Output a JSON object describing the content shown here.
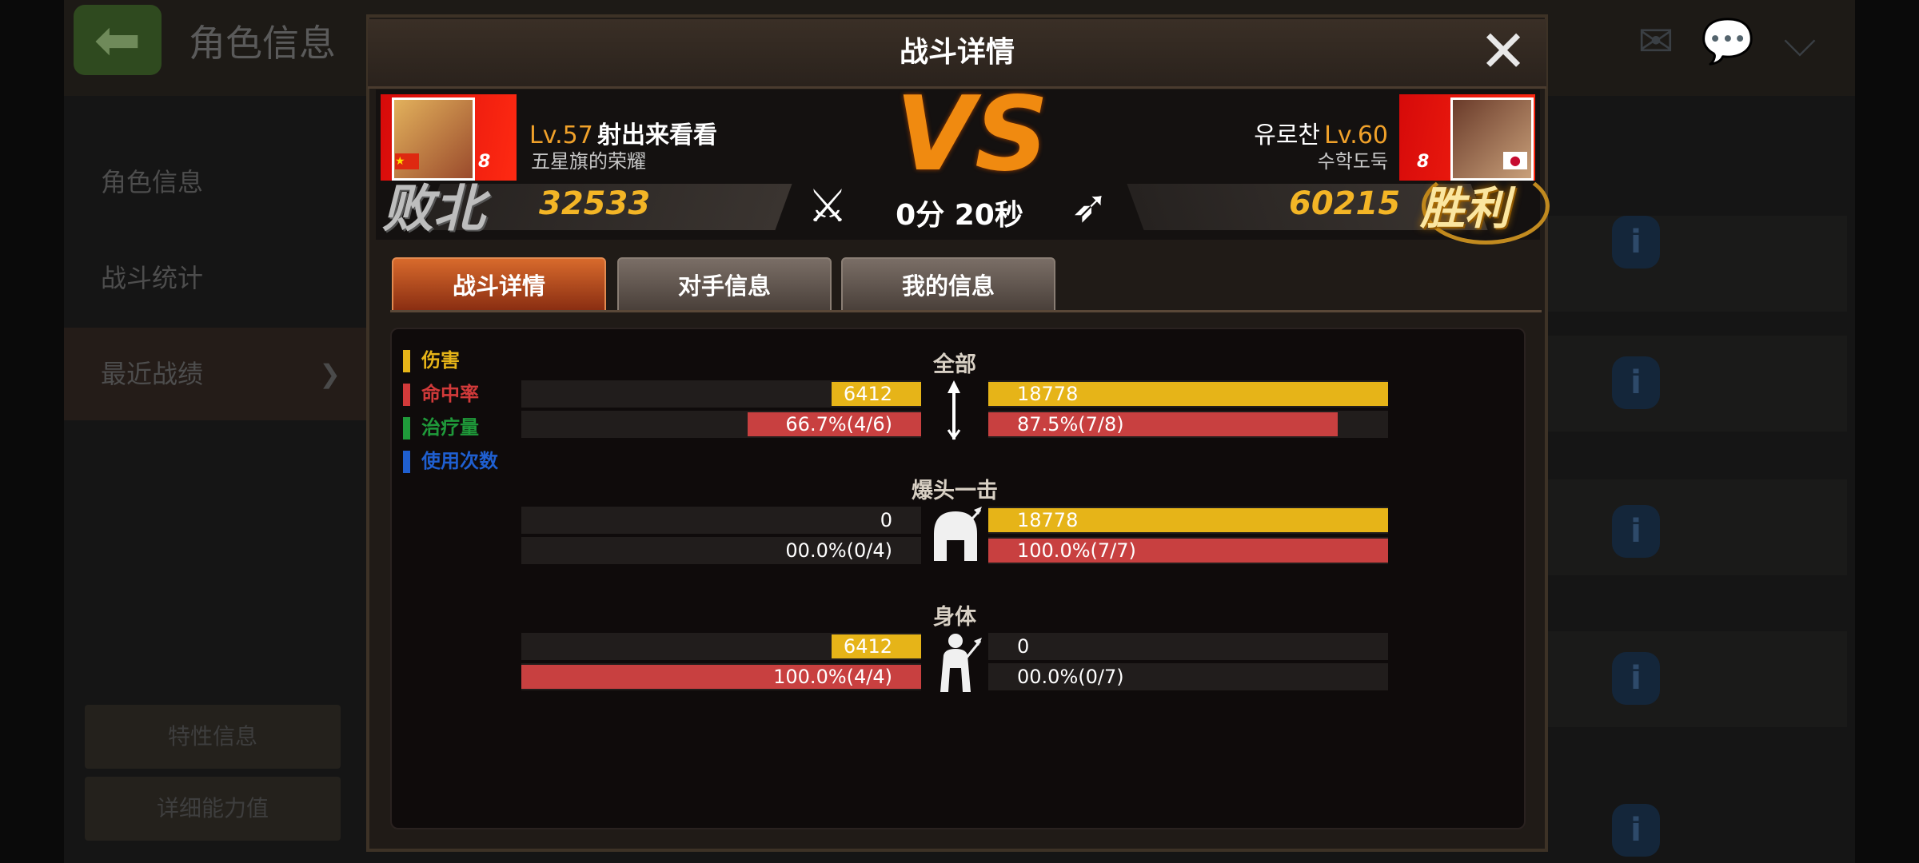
{
  "background": {
    "title": "角色信息",
    "sidebar": [
      "角色信息",
      "战斗统计",
      "最近战绩"
    ],
    "buttons": [
      "特性信息",
      "详细能力值"
    ],
    "info_icon": "i"
  },
  "modal": {
    "title": "战斗详情",
    "close_icon": "close-icon"
  },
  "left_player": {
    "level": "Lv.57",
    "name": "射出来看看",
    "guild": "五星旗的荣耀",
    "badge": "8",
    "score": "32533",
    "result": "败北"
  },
  "right_player": {
    "level": "Lv.60",
    "name": "유로찬",
    "guild": "수학도둑",
    "badge": "8",
    "score": "60215",
    "result": "胜利"
  },
  "vs": "VS",
  "time": "0分 20秒",
  "tabs": [
    "战斗详情",
    "对手信息",
    "我的信息"
  ],
  "legend": [
    {
      "label": "伤害",
      "color": "#e6b418"
    },
    {
      "label": "命中率",
      "color": "#d23a3a"
    },
    {
      "label": "治疗量",
      "color": "#1f9a3a"
    },
    {
      "label": "使用次数",
      "color": "#1f5fd0"
    }
  ],
  "sections": [
    {
      "title": "全部",
      "icon": "arrow-icon",
      "left_damage": "6412",
      "left_damage_fill": 0.224,
      "left_hit": "66.7%(4/6)",
      "left_hit_fill": 0.434,
      "right_damage": "18778",
      "right_damage_fill": 1.0,
      "right_hit": "87.5%(7/8)",
      "right_hit_fill": 0.874
    },
    {
      "title": "爆头一击",
      "icon": "helmet-icon",
      "left_damage": "0",
      "left_damage_fill": 0,
      "left_hit": "00.0%(0/4)",
      "left_hit_fill": 0,
      "right_damage": "18778",
      "right_damage_fill": 1.0,
      "right_hit": "100.0%(7/7)",
      "right_hit_fill": 1.0
    },
    {
      "title": "身体",
      "icon": "body-icon",
      "left_damage": "6412",
      "left_damage_fill": 0.224,
      "left_hit": "100.0%(4/4)",
      "left_hit_fill": 1.0,
      "right_damage": "0",
      "right_damage_fill": 0,
      "right_hit": "00.0%(0/7)",
      "right_hit_fill": 0
    }
  ]
}
